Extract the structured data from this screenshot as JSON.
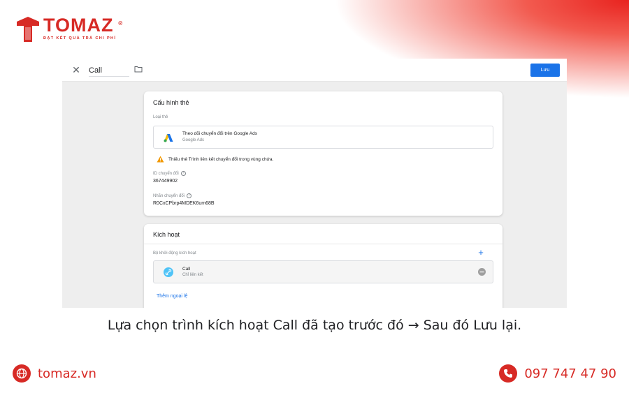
{
  "brand": {
    "name": "TOMAZ",
    "registered": "®",
    "slogan": "ĐẠT KẾT QUẢ TRẢ CHI PHÍ",
    "accent": "#d72a25"
  },
  "editor": {
    "tag_name": "Call",
    "save_label": "Lưu",
    "save_color": "#1a73e8"
  },
  "tag_config": {
    "title": "Cấu hình thẻ",
    "tag_type_label": "Loại thẻ",
    "tag_type_name": "Theo dõi chuyển đổi trên Google Ads",
    "tag_type_sub": "Google Ads",
    "warning": "Thiếu thẻ Trình liên kết chuyển đổi trong vùng chứa.",
    "conversion_id_label": "ID chuyển đổi",
    "conversion_id": "367449902",
    "conversion_label_label": "Nhãn chuyển đổi",
    "conversion_label": "R0CxCPbrp4MDEK6um68B"
  },
  "triggering": {
    "title": "Kích hoạt",
    "firing_triggers_label": "Bộ khởi động kích hoạt",
    "trigger_name": "Call",
    "trigger_type": "Chỉ liên kết",
    "add_exception": "Thêm ngoại lệ"
  },
  "caption": "Lựa chọn trình kích hoạt Call đã tạo trước đó → Sau đó Lưu lại.",
  "footer": {
    "website": "tomaz.vn",
    "phone": "097 747 47 90"
  },
  "icons": [
    "close-icon",
    "folder-icon",
    "google-ads-icon",
    "warning-icon",
    "help-icon",
    "add-icon",
    "link-icon",
    "remove-icon",
    "globe-icon",
    "phone-icon"
  ]
}
